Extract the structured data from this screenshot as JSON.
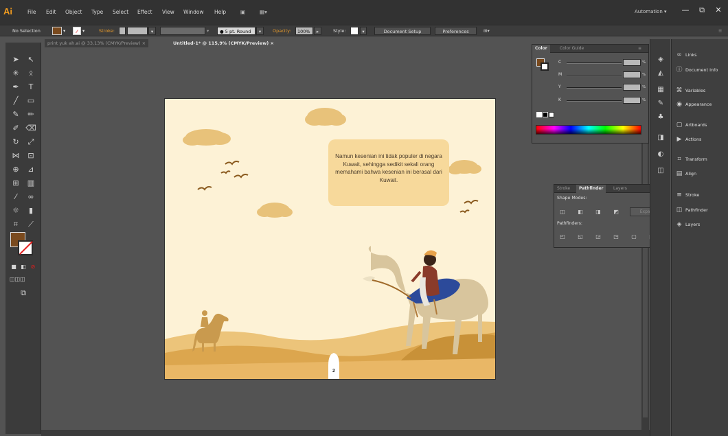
{
  "app": {
    "logo": "Ai",
    "workspace": "Automation"
  },
  "menu": [
    "File",
    "Edit",
    "Object",
    "Type",
    "Select",
    "Effect",
    "View",
    "Window",
    "Help"
  ],
  "window_controls": {
    "minimize": "—",
    "restore": "⧉",
    "close": "✕"
  },
  "control_bar": {
    "selection": "No Selection",
    "stroke_label": "Stroke:",
    "brush": "5 pt. Round",
    "opacity_label": "Opacity:",
    "opacity": "100%",
    "style_label": "Style:",
    "document_setup": "Document Setup",
    "preferences": "Preferences"
  },
  "tabs": [
    {
      "label": "print yuk ah.ai @ 33,13% (CMYK/Preview)",
      "close": "×"
    },
    {
      "label": "Untitled-1* @ 115,9% (CMYK/Preview)",
      "close": "×"
    }
  ],
  "artboard": {
    "narration": "Namun kesenian ini tidak populer di negara Kuwait, sehingga sedikit sekali orang memahami bahwa kesenian ini berasal dari Kuwait.",
    "page_number": "2"
  },
  "color_panel": {
    "tabs": [
      "Color",
      "Color Guide"
    ],
    "channels": [
      "C",
      "M",
      "Y",
      "K"
    ],
    "percent": "%"
  },
  "pathfinder_panel": {
    "tabs": [
      "Stroke",
      "Pathfinder",
      "Layers"
    ],
    "shape_modes": "Shape Modes:",
    "pathfinders": "Pathfinders:",
    "expand": "Expand"
  },
  "side_panel": [
    "Links",
    "Document Info",
    "Variables",
    "Appearance",
    "Artboards",
    "Actions",
    "Transform",
    "Align",
    "Stroke",
    "Pathfinder",
    "Layers"
  ],
  "colors": {
    "artboard_bg": "#fdf2d6",
    "cloud": "#e8c27a",
    "textbox": "#f7d99b",
    "dune_dark": "#d9a44a",
    "dune_light": "#ecc47a",
    "bird": "#8a5a1e",
    "camel": "#d8c59d",
    "accent": "#f39c1f"
  }
}
